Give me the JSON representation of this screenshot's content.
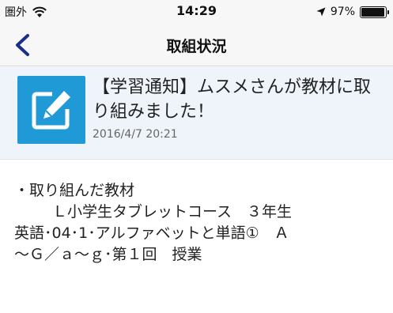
{
  "status_bar": {
    "carrier": "圏外",
    "time": "14:29",
    "battery_text": "97%",
    "battery_level": 0.97
  },
  "nav": {
    "title": "取組状況",
    "back_icon": "chevron-left-icon"
  },
  "notice": {
    "icon": "edit-note-icon",
    "icon_color": "#1f9ad6",
    "title": "【学習通知】ムスメさんが教材に取り組みました！",
    "date": "2016/4/7 20:21"
  },
  "detail": {
    "line1": "・取り組んだ教材",
    "line2": "Ｌ小学生タブレットコース　３年生",
    "line3": "英語･04･1･アルファベットと単語①　Ａ",
    "line4": "～Ｇ／ａ～ｇ･第１回　授業"
  },
  "colors": {
    "accent": "#1a2f8a",
    "notice_background": "#eef4fa"
  }
}
